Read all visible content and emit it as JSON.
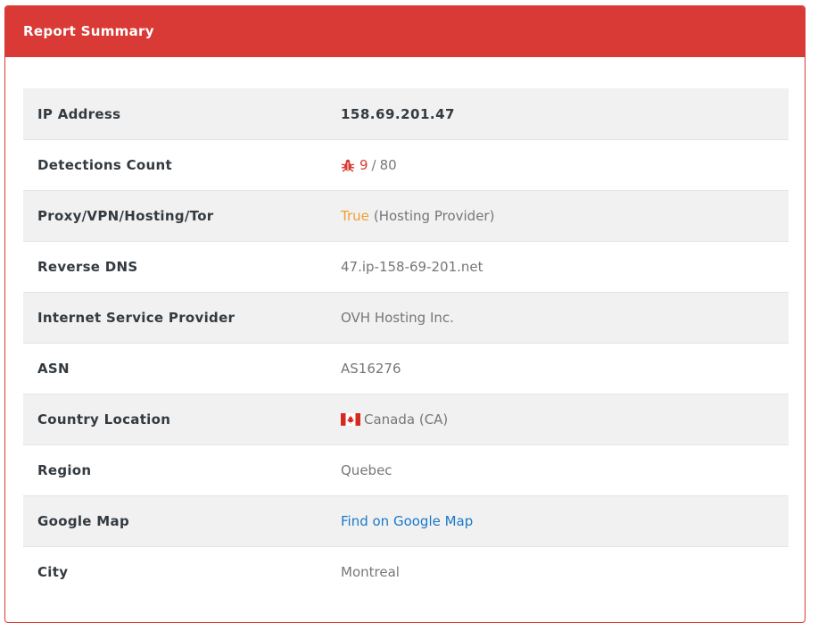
{
  "header": {
    "title": "Report Summary"
  },
  "rows": {
    "ip": {
      "label": "IP Address",
      "value": "158.69.201.47"
    },
    "detections": {
      "label": "Detections Count",
      "count": "9",
      "separator": "/",
      "total": "80"
    },
    "proxy": {
      "label": "Proxy/VPN/Hosting/Tor",
      "flag": "True",
      "detail": "(Hosting Provider)"
    },
    "rdns": {
      "label": "Reverse DNS",
      "value": "47.ip-158-69-201.net"
    },
    "isp": {
      "label": "Internet Service Provider",
      "value": "OVH Hosting Inc."
    },
    "asn": {
      "label": "ASN",
      "value": "AS16276"
    },
    "country": {
      "label": "Country Location",
      "value": "Canada (CA)",
      "flag_icon": "canada-flag-icon"
    },
    "region": {
      "label": "Region",
      "value": "Quebec"
    },
    "map": {
      "label": "Google Map",
      "link": "Find on Google Map"
    },
    "city": {
      "label": "City",
      "value": "Montreal"
    }
  },
  "colors": {
    "accent": "#d93a35",
    "warning": "#f0a030",
    "link": "#1a79c9",
    "row_alt": "#f1f1f1"
  },
  "icons": {
    "detections": "bug-icon"
  }
}
